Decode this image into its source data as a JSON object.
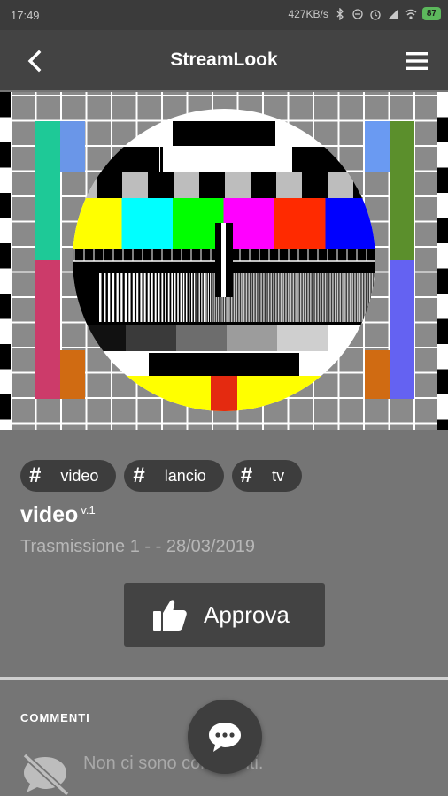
{
  "status_bar": {
    "time": "17:49",
    "network_speed": "427KB/s",
    "battery": "87"
  },
  "appbar": {
    "title": "StreamLook",
    "back_icon": "chevron-left-icon",
    "menu_icon": "hamburger-menu-icon"
  },
  "video": {
    "thumbnail": "tv-test-card"
  },
  "tags": [
    {
      "hash": "#",
      "label": "video"
    },
    {
      "hash": "#",
      "label": "lancio"
    },
    {
      "hash": "#",
      "label": "tv"
    }
  ],
  "video_info": {
    "title": "video",
    "version": "v.1",
    "subtitle": "Trasmissione 1 - - 28/03/2019"
  },
  "approve_button": {
    "label": "Approva",
    "icon": "thumbs-up-icon"
  },
  "comments": {
    "heading": "COMMENTI",
    "empty_text": "Non ci sono commenti.",
    "empty_icon": "comment-off-icon"
  },
  "fab": {
    "icon": "chat-bubble-icon"
  },
  "colors": {
    "appbar": "#434343",
    "page_background": "#757575",
    "tag_background": "#3d3d3d",
    "battery": "#5cb85c"
  }
}
